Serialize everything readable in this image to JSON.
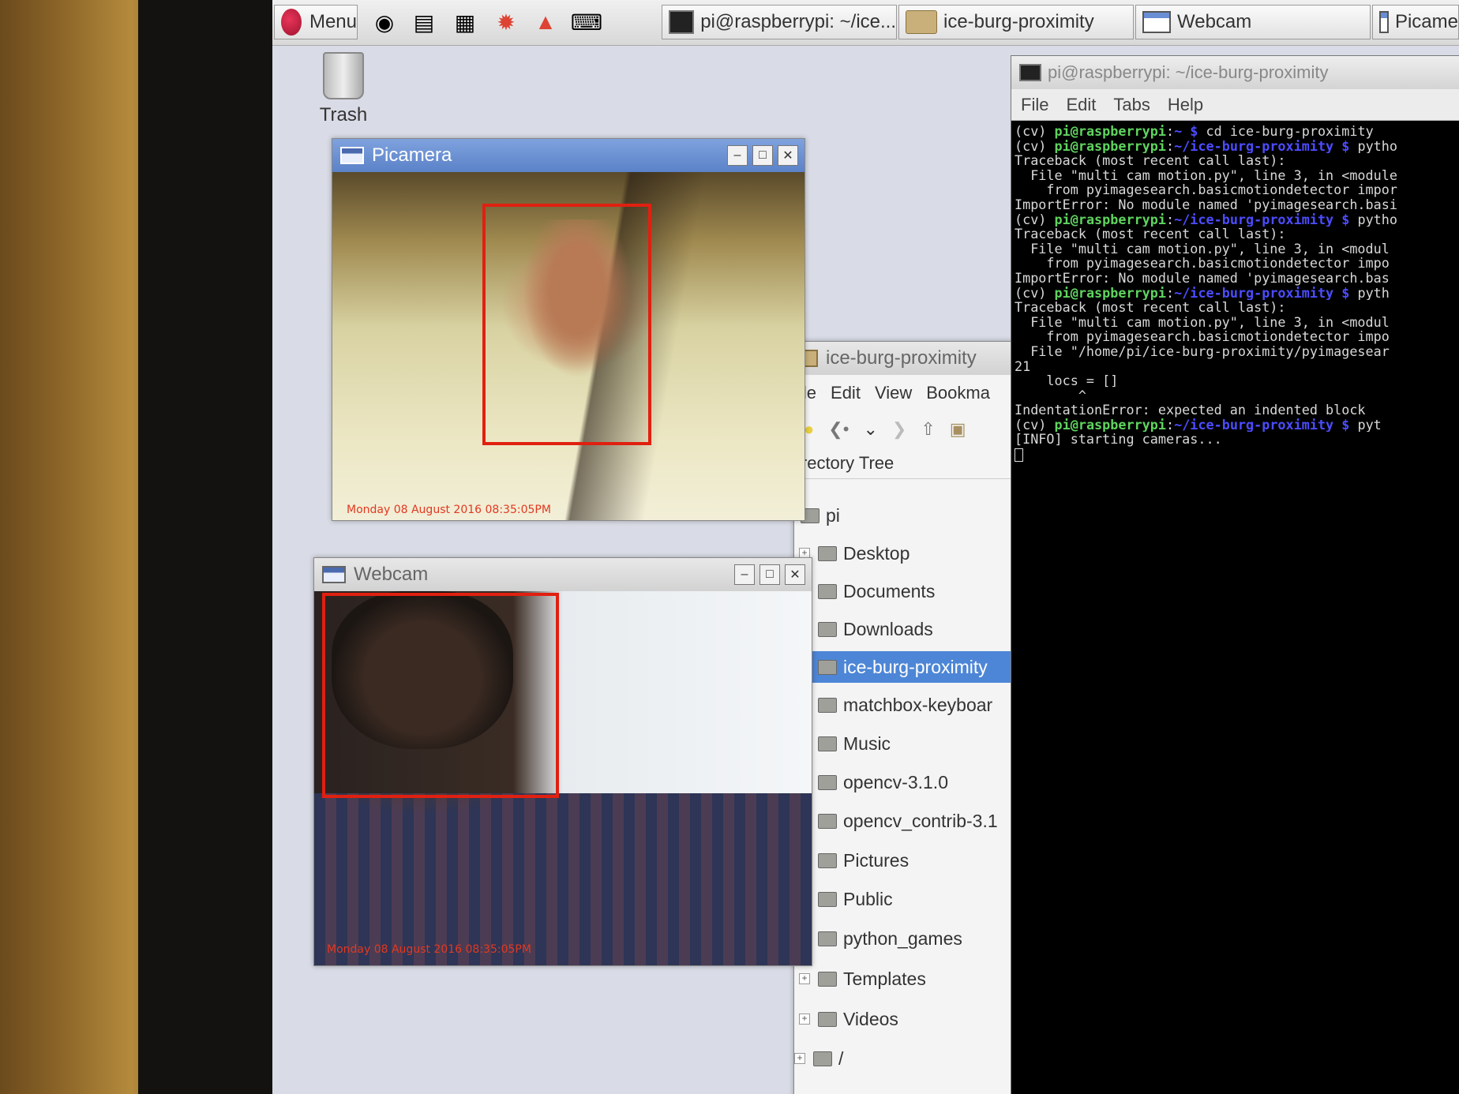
{
  "taskbar": {
    "menu_label": "Menu",
    "tasks": [
      {
        "label": "pi@raspberrypi: ~/ice...",
        "icon": "terminal-icon"
      },
      {
        "label": "ice-burg-proximity",
        "icon": "folder-icon"
      },
      {
        "label": "Webcam",
        "icon": "window-icon"
      },
      {
        "label": "Picame",
        "icon": "window-icon"
      }
    ]
  },
  "desktop": {
    "trash_label": "Trash"
  },
  "picamera": {
    "title": "Picamera",
    "timestamp": "Monday 08 August 2016 08:35:05PM"
  },
  "webcam": {
    "title": "Webcam",
    "timestamp": "Monday 08 August 2016 08:35:05PM"
  },
  "file_manager": {
    "title": "ice-burg-proximity",
    "menu": [
      "ile",
      "Edit",
      "View",
      "Bookma"
    ],
    "pane_title": "irectory Tree",
    "tree": [
      {
        "label": "pi",
        "expander": ""
      },
      {
        "label": "Desktop",
        "expander": "+"
      },
      {
        "label": "Documents",
        "expander": "+"
      },
      {
        "label": "Downloads",
        "expander": "+"
      },
      {
        "label": "ice-burg-proximity",
        "expander": "+",
        "selected": true
      },
      {
        "label": "matchbox-keyboar",
        "expander": "+"
      },
      {
        "label": "Music",
        "expander": "+"
      },
      {
        "label": "opencv-3.1.0",
        "expander": "+"
      },
      {
        "label": "opencv_contrib-3.1",
        "expander": "+"
      },
      {
        "label": "Pictures",
        "expander": "+"
      },
      {
        "label": "Public",
        "expander": "+"
      },
      {
        "label": "python_games",
        "expander": "+"
      },
      {
        "label": "Templates",
        "expander": "+"
      },
      {
        "label": "Videos",
        "expander": "+"
      },
      {
        "label": "/",
        "expander": "+"
      }
    ]
  },
  "terminal": {
    "title": "pi@raspberrypi: ~/ice-burg-proximity",
    "menu": [
      "File",
      "Edit",
      "Tabs",
      "Help"
    ],
    "lines": [
      [
        {
          "t": "(cv) ",
          "c": ""
        },
        {
          "t": "pi@raspberrypi",
          "c": "pg"
        },
        {
          "t": ":",
          "c": ""
        },
        {
          "t": "~ $",
          "c": "pb"
        },
        {
          "t": " cd ice-burg-proximity",
          "c": ""
        }
      ],
      [
        {
          "t": "(cv) ",
          "c": ""
        },
        {
          "t": "pi@raspberrypi",
          "c": "pg"
        },
        {
          "t": ":",
          "c": ""
        },
        {
          "t": "~/ice-burg-proximity $",
          "c": "pb"
        },
        {
          "t": " pytho",
          "c": ""
        }
      ],
      [
        {
          "t": "Traceback (most recent call last):",
          "c": ""
        }
      ],
      [
        {
          "t": "  File \"multi_cam_motion.py\", line 3, in <module",
          "c": ""
        }
      ],
      [
        {
          "t": "    from pyimagesearch.basicmotiondetector impor",
          "c": ""
        }
      ],
      [
        {
          "t": "ImportError: No module named 'pyimagesearch.basi",
          "c": ""
        }
      ],
      [
        {
          "t": "(cv) ",
          "c": ""
        },
        {
          "t": "pi@raspberrypi",
          "c": "pg"
        },
        {
          "t": ":",
          "c": ""
        },
        {
          "t": "~/ice-burg-proximity $",
          "c": "pb"
        },
        {
          "t": " pytho",
          "c": ""
        }
      ],
      [
        {
          "t": "Traceback (most recent call last):",
          "c": ""
        }
      ],
      [
        {
          "t": "  File \"multi_cam_motion.py\", line 3, in <modul",
          "c": ""
        }
      ],
      [
        {
          "t": "    from pyimagesearch.basicmotiondetector impo",
          "c": ""
        }
      ],
      [
        {
          "t": "ImportError: No module named 'pyimagesearch.bas",
          "c": ""
        }
      ],
      [
        {
          "t": "(cv) ",
          "c": ""
        },
        {
          "t": "pi@raspberrypi",
          "c": "pg"
        },
        {
          "t": ":",
          "c": ""
        },
        {
          "t": "~/ice-burg-proximity $",
          "c": "pb"
        },
        {
          "t": " pyth",
          "c": ""
        }
      ],
      [
        {
          "t": "Traceback (most recent call last):",
          "c": ""
        }
      ],
      [
        {
          "t": "  File \"multi_cam_motion.py\", line 3, in <modul",
          "c": ""
        }
      ],
      [
        {
          "t": "    from pyimagesearch.basicmotiondetector impo",
          "c": ""
        }
      ],
      [
        {
          "t": "  File \"/home/pi/ice-burg-proximity/pyimagesear",
          "c": ""
        }
      ],
      [
        {
          "t": "21",
          "c": ""
        }
      ],
      [
        {
          "t": "    locs = []",
          "c": ""
        }
      ],
      [
        {
          "t": "        ^",
          "c": ""
        }
      ],
      [
        {
          "t": "IndentationError: expected an indented block",
          "c": ""
        }
      ],
      [
        {
          "t": "(cv) ",
          "c": ""
        },
        {
          "t": "pi@raspberrypi",
          "c": "pg"
        },
        {
          "t": ":",
          "c": ""
        },
        {
          "t": "~/ice-burg-proximity $",
          "c": "pb"
        },
        {
          "t": " pyt",
          "c": ""
        }
      ],
      [
        {
          "t": "[INFO] starting cameras...",
          "c": ""
        }
      ]
    ]
  },
  "colors": {
    "prompt_user": "#5fd35f",
    "prompt_path": "#4c4cff",
    "detection_box": "#e02010",
    "selection": "#4d86d6"
  }
}
